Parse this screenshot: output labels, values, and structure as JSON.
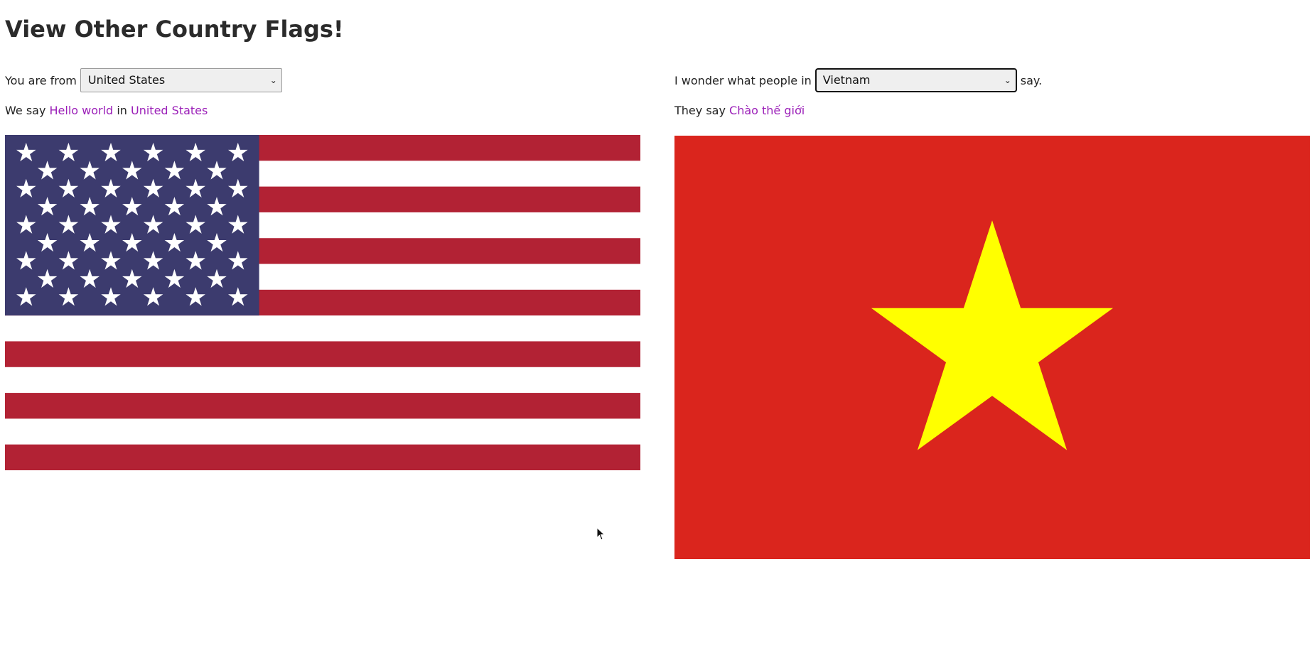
{
  "page": {
    "title": "View Other Country Flags!"
  },
  "home": {
    "label": "You are from",
    "selected_country": "United States",
    "say_prefix": "We say",
    "greeting": "Hello world",
    "say_mid": "in",
    "country_link": "United States"
  },
  "other": {
    "label": "I wonder what people in",
    "selected_country": "Vietnam",
    "after_label": "say.",
    "say_prefix": "They say",
    "greeting": "Chào thế giới"
  },
  "flags": {
    "home_flag_icon": "us-flag",
    "other_flag_icon": "vietnam-flag",
    "us_colors": {
      "red": "#b22234",
      "white": "#ffffff",
      "blue": "#3c3b6e"
    },
    "vn_colors": {
      "red": "#da251d",
      "star": "#ffff00"
    }
  },
  "colors": {
    "link": "#9b1fb8",
    "text": "#222222"
  }
}
